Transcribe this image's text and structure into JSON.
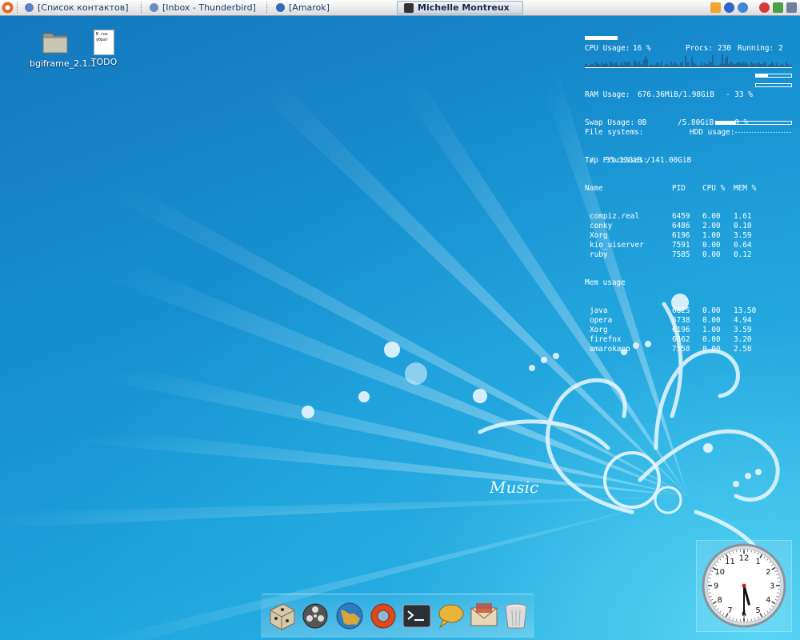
{
  "taskbar": {
    "tasks": [
      {
        "label": "[Список контактов]"
      },
      {
        "label": "[Inbox - Thunderbird]"
      },
      {
        "label": "[Amarok]"
      },
      {
        "label": "Michelle Montreux"
      }
    ]
  },
  "desktop_icons": [
    {
      "label": "bgiframe_2.1.1",
      "icon": "folder-icon"
    },
    {
      "label": "TODO",
      "icon": "text-file-icon",
      "preview": "В гнс\nубрат"
    }
  ],
  "conky": {
    "cpu_label": "CPU Usage:",
    "cpu_value": "16 %",
    "procs_label": "Procs:",
    "procs_value": "230",
    "running_label": "Running:",
    "running_value": "2",
    "cpu_fraction": 0.16,
    "ram_label": "RAM Usage:",
    "ram_value": "676.36MiB/1.98GiB",
    "ram_pct": "- 33 %",
    "ram_fraction": 0.33,
    "swap_label": "Swap Usage:",
    "swap_value": "0B",
    "swap_total": "/5.80GiB",
    "swap_pct": "- 0 %",
    "swap_fraction": 0.0,
    "fs_label": "File systems:",
    "hdd_label": "HDD usage:",
    "fs_mount": "/",
    "fs_value": "35.12GiB /141.00GiB",
    "fs_fraction": 0.25,
    "top_title": "Top Processes:",
    "headers": [
      "Name",
      "PID",
      "CPU %",
      "MEM %"
    ],
    "top_cpu": [
      [
        "compiz.real",
        "6459",
        "6.00",
        "1.61"
      ],
      [
        "conky",
        "6486",
        "2.00",
        "0.10"
      ],
      [
        "Xorg",
        "6196",
        "1.00",
        "3.59"
      ],
      [
        "kio_uiserver",
        "7591",
        "0.00",
        "0.64"
      ],
      [
        "ruby",
        "7585",
        "0.00",
        "0.12"
      ]
    ],
    "mem_title": "Mem usage",
    "top_mem": [
      [
        "java",
        "6825",
        "0.00",
        "13.50"
      ],
      [
        "opera",
        "6738",
        "0.00",
        "4.94"
      ],
      [
        "Xorg",
        "6196",
        "1.00",
        "3.59"
      ],
      [
        "firefox",
        "6462",
        "0.00",
        "3.20"
      ],
      [
        "amarokapp",
        "7558",
        "0.00",
        "2.58"
      ]
    ]
  },
  "wallpaper_text": "Music",
  "clock": {
    "numbers": [
      "12",
      "1",
      "2",
      "3",
      "4",
      "5",
      "6",
      "7",
      "8",
      "9",
      "10",
      "11"
    ],
    "hour": 5,
    "minute": 30
  },
  "dock": [
    {
      "icon": "dice-icon"
    },
    {
      "icon": "film-reel-icon"
    },
    {
      "icon": "globe-icon"
    },
    {
      "icon": "lifebuoy-icon"
    },
    {
      "icon": "terminal-icon"
    },
    {
      "icon": "chat-bubble-icon"
    },
    {
      "icon": "mail-envelope-icon"
    },
    {
      "icon": "trash-icon"
    }
  ],
  "colors": {
    "accent": "#1a8fd0",
    "panel_text": "#1e3d6e"
  }
}
